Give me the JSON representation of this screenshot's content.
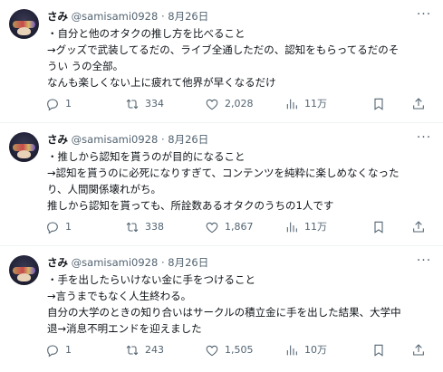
{
  "tweets": [
    {
      "name": "さみ",
      "handle": "@samisami0928",
      "dot": "·",
      "date": "8月26日",
      "lines": [
        "・自分と他のオタクの推し方を比べること",
        "→グッズで武装してるだの、ライブ全通しただの、認知をもらってるだのそ",
        "うい うの全部。",
        "なんも楽しくない上に疲れて他界が早くなるだけ"
      ],
      "replies": "1",
      "retweets": "334",
      "likes": "2,028",
      "views": "11万"
    },
    {
      "name": "さみ",
      "handle": "@samisami0928",
      "dot": "·",
      "date": "8月26日",
      "lines": [
        "・推しから認知を貰うのが目的になること",
        "→認知を貰うのに必死になりすぎて、コンテンツを純粋に楽しめなくなった",
        "り、人間関係壊れがち。",
        "推しから認知を貰っても、所詮数あるオタクのうちの1人です"
      ],
      "replies": "1",
      "retweets": "338",
      "likes": "1,867",
      "views": "11万"
    },
    {
      "name": "さみ",
      "handle": "@samisami0928",
      "dot": "·",
      "date": "8月26日",
      "lines": [
        "・手を出したらいけない金に手をつけること",
        "→言うまでもなく人生終わる。",
        "自分の大学のときの知り合いはサークルの積立金に手を出した結果、大学中",
        "退→消息不明エンドを迎えました"
      ],
      "replies": "1",
      "retweets": "243",
      "likes": "1,505",
      "views": "10万"
    }
  ],
  "icons": {
    "reply": "reply-icon",
    "retweet": "retweet-icon",
    "like": "like-icon",
    "views": "views-icon",
    "bookmark": "bookmark-icon",
    "share": "share-icon",
    "more": "more-icon"
  },
  "colors": {
    "text": "#0f1419",
    "secondary": "#536471",
    "divider": "#eff3f4"
  }
}
